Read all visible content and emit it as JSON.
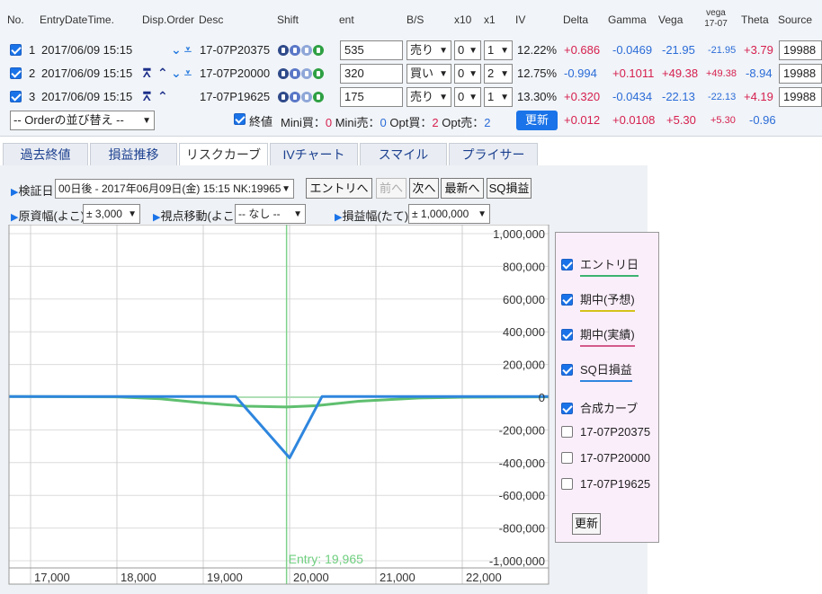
{
  "headers": {
    "no": "No.",
    "entry": "EntryDateTime.",
    "disp": "Disp.Order",
    "desc": "Desc",
    "shift": "Shift",
    "ent": "ent",
    "bs": "B/S",
    "x10": "x10",
    "x1": "x1",
    "iv": "IV",
    "delta": "Delta",
    "gamma": "Gamma",
    "vega": "Vega",
    "vega2_top": "vega",
    "vega2_bottom": "17-07",
    "theta": "Theta",
    "source": "Source"
  },
  "rows": [
    {
      "no": "1",
      "date": "2017/06/09 15:15",
      "desc": "17-07P20375",
      "ent": "535",
      "bs": "売り",
      "x10": "0",
      "x1": "1",
      "iv": "12.22%",
      "delta": "+0.686",
      "gamma": "-0.0469",
      "vega": "-21.95",
      "vega2": "-21.95",
      "theta": "+3.79",
      "source": "19988"
    },
    {
      "no": "2",
      "date": "2017/06/09 15:15",
      "desc": "17-07P20000",
      "ent": "320",
      "bs": "買い",
      "x10": "0",
      "x1": "2",
      "iv": "12.75%",
      "delta": "-0.994",
      "gamma": "+0.1011",
      "vega": "+49.38",
      "vega2": "+49.38",
      "theta": "-8.94",
      "source": "19988"
    },
    {
      "no": "3",
      "date": "2017/06/09 15:15",
      "desc": "17-07P19625",
      "ent": "175",
      "bs": "売り",
      "x10": "0",
      "x1": "1",
      "iv": "13.30%",
      "delta": "+0.320",
      "gamma": "-0.0434",
      "vega": "-22.13",
      "vega2": "-22.13",
      "theta": "+4.19",
      "source": "19988"
    }
  ],
  "footer": {
    "order_sort": "-- Orderの並び替え --",
    "close_label": "終値",
    "mini_buy_label": "Mini買：",
    "mini_buy": "0",
    "mini_sell_label": "Mini売：",
    "mini_sell": "0",
    "opt_buy_label": "Opt買：",
    "opt_buy": "2",
    "opt_sell_label": "Opt売：",
    "opt_sell": "2",
    "update": "更新",
    "delta": "+0.012",
    "gamma": "+0.0108",
    "vega": "+5.30",
    "vega2": "+5.30",
    "theta": "-0.96"
  },
  "tabs": [
    "過去終値",
    "損益推移",
    "リスクカーブ",
    "IVチャート",
    "スマイル",
    "プライサー"
  ],
  "controls": {
    "verify_label": "検証日",
    "verify_value": "00日後 - 2017年06月09日(金) 15:15 NK:19965",
    "btn_entry": "エントリへ",
    "btn_prev": "前へ",
    "btn_next": "次へ",
    "btn_latest": "最新へ",
    "btn_sq": "SQ損益",
    "price_range_label": "原資幅(よこ)",
    "price_range_value": "± 3,000",
    "view_shift_label": "視点移動(よこ)",
    "view_shift_value": "-- なし --",
    "pl_range_label": "損益幅(たて)",
    "pl_range_value": "± 1,000,000"
  },
  "legend": {
    "items": [
      {
        "label": "エントリ日",
        "checked": true,
        "color": "#3cb371"
      },
      {
        "label": "期中(予想)",
        "checked": true,
        "color": "#d4c21a"
      },
      {
        "label": "期中(実績)",
        "checked": true,
        "color": "#d45a8a"
      },
      {
        "label": "SQ日損益",
        "checked": true,
        "color": "#2e86de"
      },
      {
        "label": "合成カーブ",
        "checked": true,
        "color": ""
      },
      {
        "label": "17-07P20375",
        "checked": false,
        "color": ""
      },
      {
        "label": "17-07P20000",
        "checked": false,
        "color": ""
      },
      {
        "label": "17-07P19625",
        "checked": false,
        "color": ""
      }
    ],
    "update": "更新"
  },
  "chart_data": {
    "type": "line",
    "x_range": [
      16750,
      23000
    ],
    "ylim": [
      -1000000,
      1000000
    ],
    "x_ticks": [
      17000,
      18000,
      19000,
      20000,
      21000,
      22000
    ],
    "x_tick_labels": [
      "17,000",
      "18,000",
      "19,000",
      "20,000",
      "21,000",
      "22,000"
    ],
    "y_ticks": [
      1000000,
      800000,
      600000,
      400000,
      200000,
      0,
      -200000,
      -400000,
      -600000,
      -800000,
      -1000000
    ],
    "y_tick_labels": [
      "1,000,000",
      "800,000",
      "600,000",
      "400,000",
      "200,000",
      "0",
      "-200,000",
      "-400,000",
      "-600,000",
      "-800,000",
      "-1,000,000"
    ],
    "entry_x": 19965,
    "entry_label": "Entry: 19,965",
    "series": [
      {
        "name": "SQ日損益",
        "color": "#2e86de",
        "x": [
          16750,
          19375,
          20000,
          20375,
          23000
        ],
        "y": [
          4000,
          4000,
          -371000,
          4000,
          4000
        ]
      },
      {
        "name": "エントリ日",
        "color": "#5fbf6f",
        "x": [
          16750,
          18000,
          18500,
          19000,
          19500,
          19965,
          20300,
          20800,
          21500,
          22000,
          23000
        ],
        "y": [
          4000,
          2000,
          -10000,
          -35000,
          -55000,
          -60000,
          -52000,
          -25000,
          -5000,
          0,
          2000
        ]
      }
    ]
  }
}
